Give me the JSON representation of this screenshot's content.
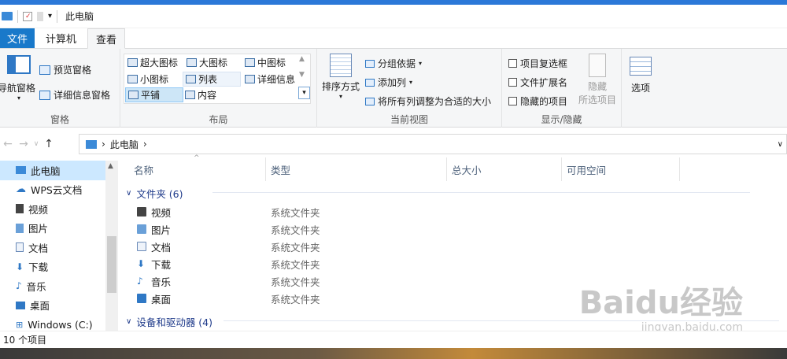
{
  "titlebar": {
    "title": "此电脑",
    "dropdown": "▾"
  },
  "tabs": {
    "file": "文件",
    "computer": "计算机",
    "view": "查看"
  },
  "ribbon": {
    "panes": {
      "nav_pane": "导航窗格",
      "preview_pane": "预览窗格",
      "details_pane": "详细信息窗格",
      "group_label": "窗格"
    },
    "layout": {
      "items": [
        "超大图标",
        "大图标",
        "中图标",
        "小图标",
        "列表",
        "详细信息",
        "平铺",
        "内容"
      ],
      "group_label": "布局"
    },
    "current_view": {
      "sort_by": "排序方式",
      "group_by": "分组依据",
      "add_column": "添加列",
      "fit_columns": "将所有列调整为合适的大小",
      "group_label": "当前视图"
    },
    "show_hide": {
      "item_checkboxes": "项目复选框",
      "file_extensions": "文件扩展名",
      "hidden_items": "隐藏的项目",
      "hide_selected_1": "隐藏",
      "hide_selected_2": "所选项目",
      "group_label": "显示/隐藏"
    },
    "options": {
      "label": "选项"
    }
  },
  "address": {
    "location": "此电脑"
  },
  "sidebar": {
    "items": [
      {
        "label": "此电脑",
        "color": "#3b8ad8"
      },
      {
        "label": "WPS云文档",
        "color": "#2f78c5"
      },
      {
        "label": "视频",
        "color": "#444"
      },
      {
        "label": "图片",
        "color": "#6aa0d8"
      },
      {
        "label": "文档",
        "color": "#6a8ab8"
      },
      {
        "label": "下载",
        "color": "#2f78c5"
      },
      {
        "label": "音乐",
        "color": "#2f78c5"
      },
      {
        "label": "桌面",
        "color": "#2f78c5"
      },
      {
        "label": "Windows (C:)",
        "color": "#2f78c5"
      }
    ]
  },
  "columns": {
    "name": "名称",
    "type": "类型",
    "total_size": "总大小",
    "free_space": "可用空间"
  },
  "sections": {
    "folders": "文件夹 (6)",
    "devices": "设备和驱动器 (4)"
  },
  "folders": [
    {
      "name": "视频",
      "type": "系统文件夹",
      "color": "#444"
    },
    {
      "name": "图片",
      "type": "系统文件夹",
      "color": "#6aa0d8"
    },
    {
      "name": "文档",
      "type": "系统文件夹",
      "color": "#8aa8c8"
    },
    {
      "name": "下载",
      "type": "系统文件夹",
      "color": "#2f78c5"
    },
    {
      "name": "音乐",
      "type": "系统文件夹",
      "color": "#2f78c5"
    },
    {
      "name": "桌面",
      "type": "系统文件夹",
      "color": "#2f78c5"
    }
  ],
  "status": {
    "count": "10 个项目"
  },
  "watermark": {
    "main": "Baidu经验",
    "sub": "jingyan.baidu.com"
  }
}
